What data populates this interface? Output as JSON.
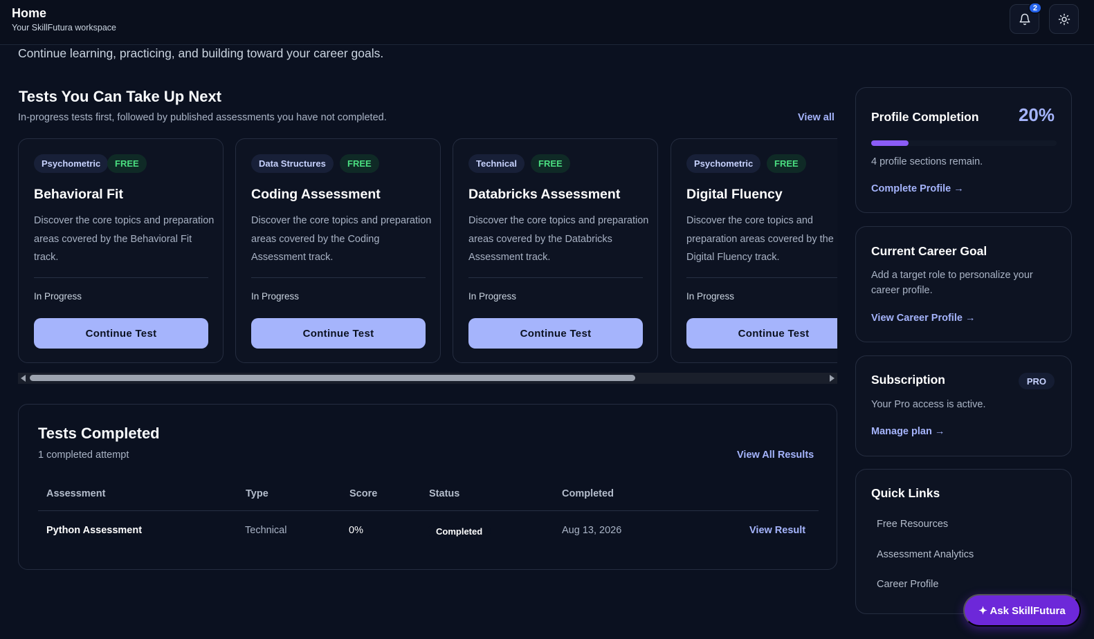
{
  "header": {
    "title": "Home",
    "subtitle": "Your SkillFutura workspace",
    "notification_count": "2",
    "bell_icon": "bell-icon",
    "theme_icon": "sun-icon"
  },
  "intro": "Continue learning, practicing, and building toward your career goals.",
  "next_tests": {
    "title": "Tests You Can Take Up Next",
    "subtitle": "In-progress tests first, followed by published assessments you have not completed.",
    "view_all": "View all",
    "cards": [
      {
        "category": "Psychometric",
        "price": "FREE",
        "title": "Behavioral Fit",
        "description": "Discover the core topics and preparation areas covered by the Behavioral Fit track.",
        "status": "In Progress",
        "button": "Continue Test"
      },
      {
        "category": "Data Structures",
        "price": "FREE",
        "title": "Coding Assessment",
        "description": "Discover the core topics and preparation areas covered by the Coding Assessment track.",
        "status": "In Progress",
        "button": "Continue Test"
      },
      {
        "category": "Technical",
        "price": "FREE",
        "title": "Databricks Assessment",
        "description": "Discover the core topics and preparation areas covered by the Databricks Assessment track.",
        "status": "In Progress",
        "button": "Continue Test"
      },
      {
        "category": "Psychometric",
        "price": "FREE",
        "title": "Digital Fluency",
        "description": "Discover the core topics and preparation areas covered by the Digital Fluency track.",
        "status": "In Progress",
        "button": "Continue Test"
      }
    ]
  },
  "completed": {
    "title": "Tests Completed",
    "subtitle": "1 completed attempt",
    "view_all": "View All Results",
    "columns": [
      "Assessment",
      "Type",
      "Score",
      "Status",
      "Completed"
    ],
    "rows": [
      {
        "assessment": "Python Assessment",
        "type": "Technical",
        "score": "0%",
        "status": "Completed",
        "completed": "Aug 13, 2026",
        "action": "View Result"
      }
    ]
  },
  "profile": {
    "title": "Profile Completion",
    "percent": "20%",
    "progress": 0.2,
    "remaining": "4 profile sections remain.",
    "link": "Complete Profile →"
  },
  "career_goal": {
    "title": "Current Career Goal",
    "text": "Add a target role to personalize your career profile.",
    "link": "View Career Profile →"
  },
  "subscription": {
    "title": "Subscription",
    "badge": "PRO",
    "text": "Your Pro access is active.",
    "link": "Manage plan →"
  },
  "quick_links": {
    "title": "Quick Links",
    "items": [
      "Free Resources",
      "Assessment Analytics",
      "Career Profile"
    ]
  },
  "assistant": {
    "label": "✦ Ask SkillFutura"
  },
  "colors": {
    "accent": "#a5b4fc",
    "background": "#0b1120",
    "progress": "#8b5cf6",
    "assistant": "#6d28d9",
    "free_tag": "#4ade80"
  }
}
